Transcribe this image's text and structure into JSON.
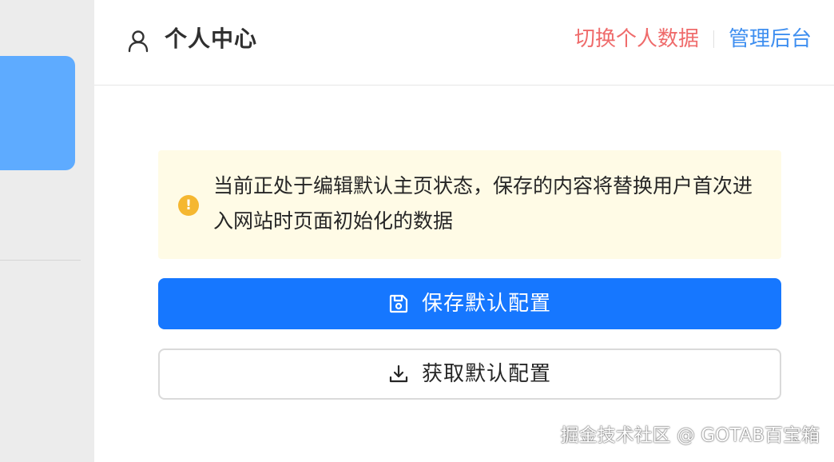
{
  "header": {
    "title": "个人中心",
    "user_icon": "user-icon",
    "switch_data_label": "切换个人数据",
    "admin_label": "管理后台"
  },
  "notice": {
    "icon": "warning-icon",
    "icon_glyph": "!",
    "text": "当前正处于编辑默认主页状态，保存的内容将替换用户首次进入网站时页面初始化的数据"
  },
  "buttons": {
    "save": {
      "icon": "save-icon",
      "label": "保存默认配置"
    },
    "fetch": {
      "icon": "download-icon",
      "label": "获取默认配置"
    }
  },
  "watermark": "掘金技术社区 @ GOTAB百宝箱",
  "colors": {
    "sidebar_accent": "#5eabff",
    "switch_link": "#ef6b6b",
    "admin_link": "#3f8ff0",
    "primary_button": "#1677ff",
    "notice_bg": "#fffbe6",
    "warning_icon": "#f5b731"
  }
}
